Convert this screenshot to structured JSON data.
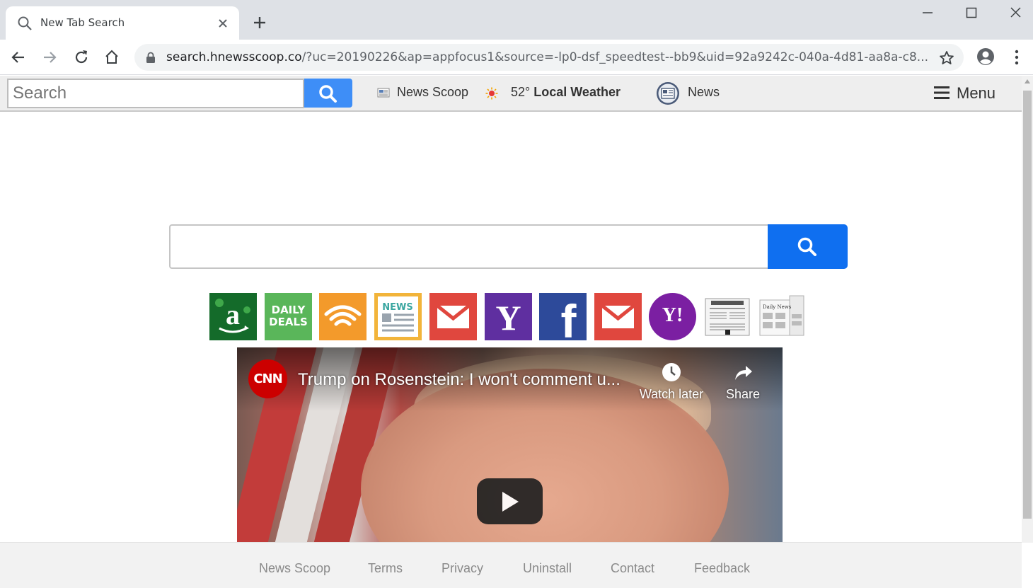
{
  "browser": {
    "tab_title": "New Tab Search",
    "url_host": "search.hnewsscoop.co",
    "url_rest": "/?uc=20190226&ap=appfocus1&source=-lp0-dsf_speedtest--bb9&uid=92a9242c-040a-4d81-aa8a-c8..."
  },
  "header": {
    "search_placeholder": "Search",
    "news_scoop_label": "News Scoop",
    "weather_temp": "52°",
    "weather_label": "Local Weather",
    "news_label": "News",
    "menu_label": "Menu"
  },
  "shortcuts": [
    {
      "name": "amazon",
      "label": "a",
      "color": "#1a7a2e"
    },
    {
      "name": "daily-deals",
      "label": "DAILY DEALS",
      "color": "#5cb85c"
    },
    {
      "name": "audible",
      "label": "",
      "color": "#f39a2b"
    },
    {
      "name": "news",
      "label": "NEWS",
      "color": "#f2b43a"
    },
    {
      "name": "gmail",
      "label": "",
      "color": "#e0473e"
    },
    {
      "name": "yahoo",
      "label": "Y",
      "color": "#5f2fa0"
    },
    {
      "name": "facebook",
      "label": "f",
      "color": "#2d4a9a"
    },
    {
      "name": "gmail-2",
      "label": "",
      "color": "#e0473e"
    },
    {
      "name": "yahoo-round",
      "label": "Y!",
      "color": "#7b1fa2"
    },
    {
      "name": "daily-news-1",
      "label": "",
      "color": "#ffffff"
    },
    {
      "name": "daily-news-2",
      "label": "",
      "color": "#ffffff"
    }
  ],
  "video": {
    "channel": "CNN",
    "title": "Trump on Rosenstein: I won't comment u...",
    "watch_later_label": "Watch later",
    "share_label": "Share"
  },
  "footer": {
    "links": [
      "News Scoop",
      "Terms",
      "Privacy",
      "Uninstall",
      "Contact",
      "Feedback"
    ]
  },
  "colors": {
    "search_button": "#0f6ff0",
    "header_search_button": "#3e8ef7",
    "header_bg": "#eeeeee",
    "footer_bg": "#f2f2f2"
  }
}
